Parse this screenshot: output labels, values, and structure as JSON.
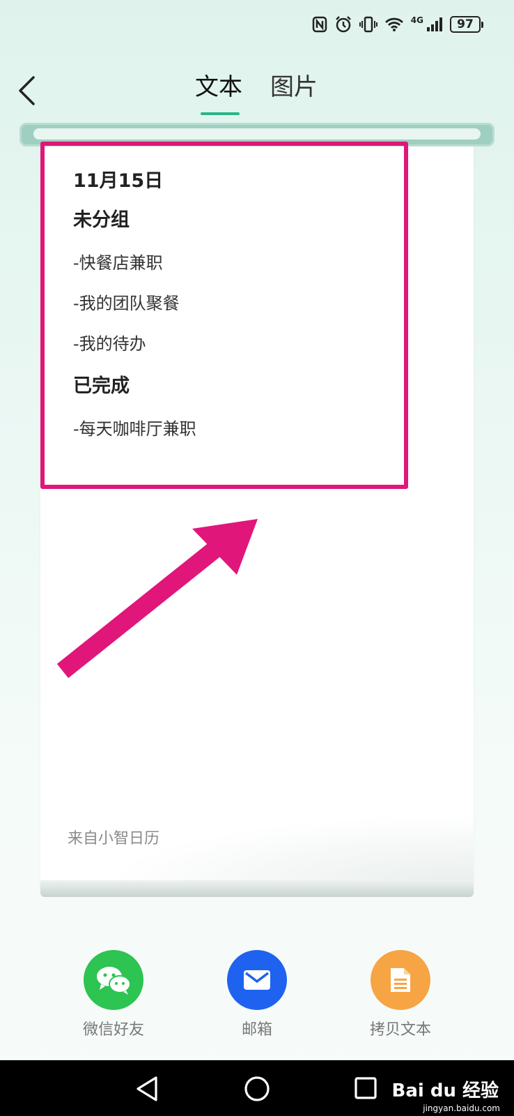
{
  "status_bar": {
    "network": "4G",
    "battery": "97"
  },
  "header": {
    "tabs": [
      {
        "label": "文本",
        "active": true
      },
      {
        "label": "图片",
        "active": false
      }
    ]
  },
  "note": {
    "date": "11月15日",
    "groups": [
      {
        "title": "未分组",
        "items": [
          "-快餐店兼职",
          "-我的团队聚餐",
          "-我的待办"
        ]
      },
      {
        "title": "已完成",
        "items": [
          "-每天咖啡厅兼职"
        ]
      }
    ],
    "source": "来自小智日历"
  },
  "share": [
    {
      "label": "微信好友",
      "icon": "wechat-icon",
      "color": "#2dc452"
    },
    {
      "label": "邮箱",
      "icon": "mail-icon",
      "color": "#1f62f0"
    },
    {
      "label": "拷贝文本",
      "icon": "document-icon",
      "color": "#f7a444"
    }
  ],
  "colors": {
    "accent": "#2bb489",
    "highlight": "#e0167a"
  },
  "watermark": {
    "brand": "Bai du 经验",
    "url": "jingyan.baidu.com"
  }
}
